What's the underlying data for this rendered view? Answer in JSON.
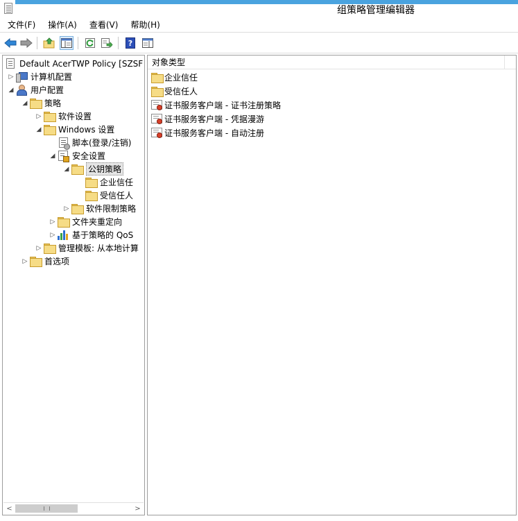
{
  "window": {
    "title": "组策略管理编辑器"
  },
  "menu": {
    "items": [
      "文件(F)",
      "操作(A)",
      "查看(V)",
      "帮助(H)"
    ]
  },
  "toolbar": {
    "icons": [
      "back-arrow-icon",
      "forward-arrow-icon",
      "up-folder-icon",
      "show-hide-tree-icon",
      "refresh-icon",
      "export-list-icon",
      "help-icon",
      "properties-pane-icon"
    ]
  },
  "tree": {
    "items": [
      {
        "label": "Default AcerTWP Policy [SZSF",
        "expander": "",
        "icon": "policy-document-icon"
      },
      {
        "label": "计算机配置",
        "expander": "▷",
        "icon": "computer-icon"
      },
      {
        "label": "用户配置",
        "expander": "◢",
        "icon": "user-icon"
      },
      {
        "label": "策略",
        "expander": "◢",
        "icon": "folder-icon"
      },
      {
        "label": "软件设置",
        "expander": "▷",
        "icon": "folder-icon"
      },
      {
        "label": "Windows 设置",
        "expander": "◢",
        "icon": "folder-icon"
      },
      {
        "label": "脚本(登录/注销)",
        "expander": "",
        "icon": "script-icon"
      },
      {
        "label": "安全设置",
        "expander": "◢",
        "icon": "security-settings-icon"
      },
      {
        "label": "公钥策略",
        "expander": "◢",
        "icon": "folder-icon"
      },
      {
        "label": "企业信任",
        "expander": "",
        "icon": "folder-icon"
      },
      {
        "label": "受信任人",
        "expander": "",
        "icon": "folder-icon"
      },
      {
        "label": "软件限制策略",
        "expander": "▷",
        "icon": "folder-icon"
      },
      {
        "label": "文件夹重定向",
        "expander": "▷",
        "icon": "folder-icon"
      },
      {
        "label": "基于策略的 QoS",
        "expander": "▷",
        "icon": "qos-chart-icon"
      },
      {
        "label": "管理模板: 从本地计算",
        "expander": "▷",
        "icon": "folder-icon"
      },
      {
        "label": "首选项",
        "expander": "▷",
        "icon": "folder-icon"
      }
    ],
    "selected_index": 8
  },
  "list": {
    "column_header": "对象类型",
    "items": [
      {
        "label": "企业信任",
        "icon": "folder-icon"
      },
      {
        "label": "受信任人",
        "icon": "folder-icon"
      },
      {
        "label": "证书服务客户端 - 证书注册策略",
        "icon": "certificate-icon"
      },
      {
        "label": "证书服务客户端 - 凭据漫游",
        "icon": "certificate-icon"
      },
      {
        "label": "证书服务客户端 - 自动注册",
        "icon": "certificate-icon"
      }
    ]
  },
  "colors": {
    "accent_strip": "#4aa3df",
    "folder_fill": "#f6dc86",
    "selection": "#e5e5e5"
  }
}
